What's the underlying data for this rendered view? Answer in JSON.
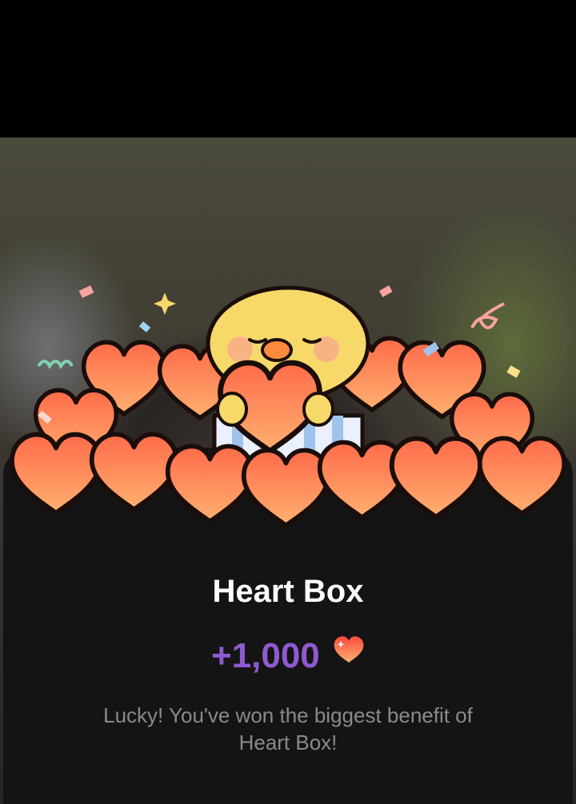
{
  "card": {
    "title": "Heart Box",
    "amount": "+1,000",
    "description": "Lucky! You've won the biggest benefit of Heart Box!"
  },
  "icons": {
    "reward": "heart-icon",
    "mascot": "chick-mascot-icon"
  },
  "colors": {
    "amount": "#8e5ad0",
    "heart": "#ff5a3c",
    "card_bg": "#141414"
  }
}
